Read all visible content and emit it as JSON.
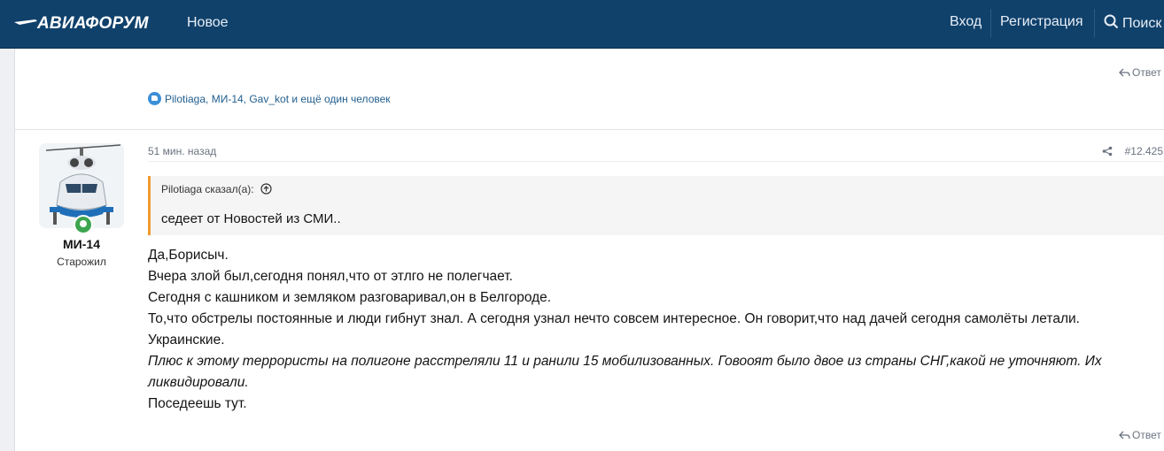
{
  "header": {
    "logo_text": "АВИАФОРУМ",
    "nav_new": "Новое",
    "login": "Вход",
    "register": "Регистрация",
    "search": "Поиск"
  },
  "prev_post": {
    "reply_label": "Ответ",
    "reactions_text": "Pilotiaga, МИ-14, Gav_kot и ещё один человек"
  },
  "post": {
    "author_name": "МИ-14",
    "author_title": "Старожил",
    "time": "51 мин. назад",
    "number": "#12.425",
    "quote_author": "Pilotiaga сказал(а):",
    "quote_text": "седеет от Новостей из СМИ..",
    "lines": [
      "Да,Борисыч.",
      "Вчера злой был,сегодня понял,что от этлго не полегчает.",
      "Сегодня с кашником и земляком разговаривал,он в Белгороде.",
      "То,что обстрелы постоянные и люди гибнут знал. А сегодня узнал нечто совсем интересное. Он говорит,что над дачей сегодня самолёты летали.",
      "Украинские."
    ],
    "italic_lines": [
      "Плюс к этому террористы на полигоне расстреляли 11 и ранили 15 мобилизованных. Говооят было двое из страны СНГ,какой не уточняют. Их",
      "ликвидировали."
    ],
    "last_line": "Поседеешь тут.",
    "reply_label": "Ответ"
  },
  "colors": {
    "header_bg": "#10416b",
    "quote_accent": "#f29a2e",
    "online": "#3da44f"
  }
}
